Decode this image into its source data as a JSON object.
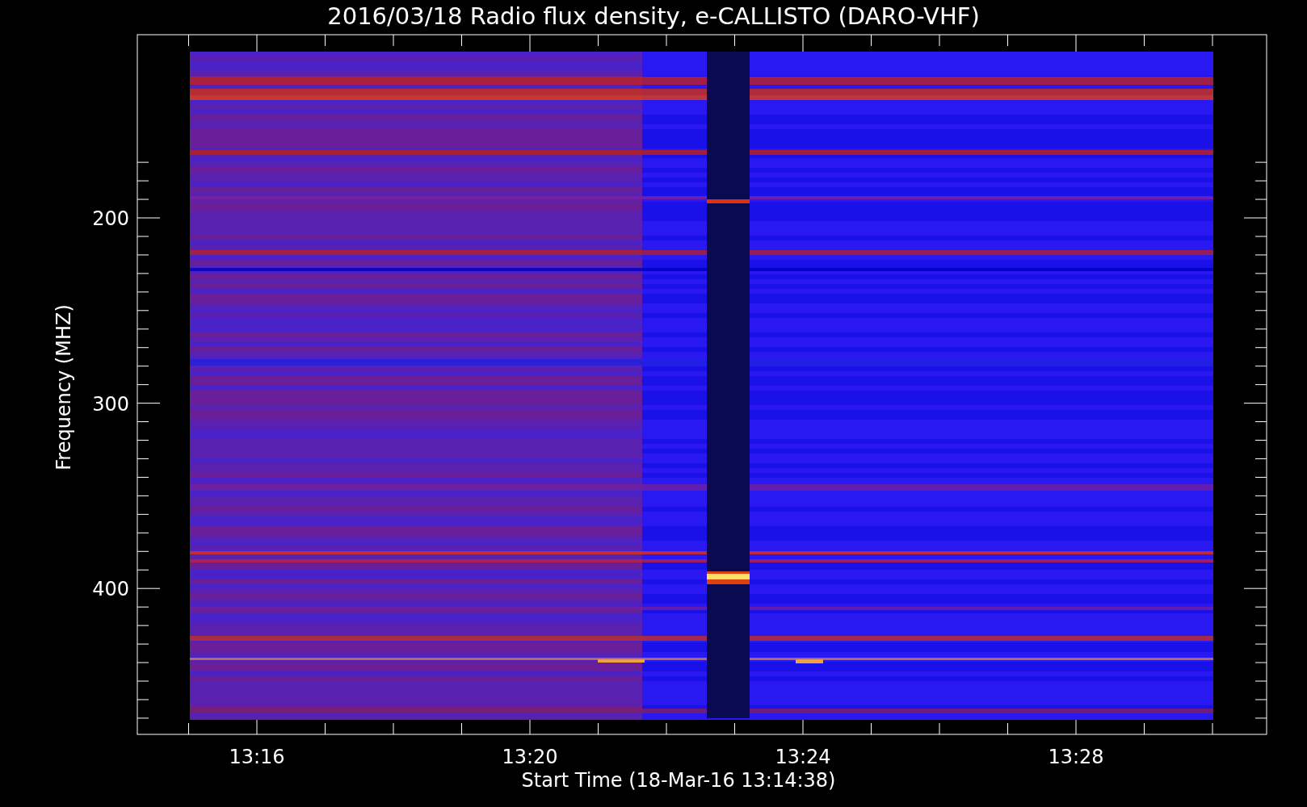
{
  "plot": {
    "title": "2016/03/18  Radio flux density, e-CALLISTO (DARO-VHF)",
    "ylabel": "Frequency (MHZ)",
    "xlabel": "Start Time (18-Mar-16 13:14:38)",
    "y_tick_labels": [
      "200",
      "300",
      "400"
    ],
    "x_tick_labels": [
      "13:16",
      "13:20",
      "13:24",
      "13:28"
    ]
  }
}
